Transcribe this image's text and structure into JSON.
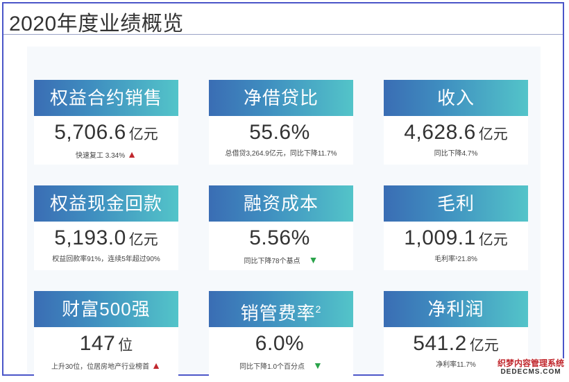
{
  "page": {
    "title": "2020年度业绩概览"
  },
  "cards": [
    {
      "title": "权益合约销售",
      "value": "5,706.6",
      "unit": "亿元",
      "note": "快速复工 3.34%",
      "arrow": "up"
    },
    {
      "title": "净借贷比",
      "value": "55.6%",
      "unit": "",
      "note": "总借贷3,264.9亿元，同比下降11.7%",
      "arrow": ""
    },
    {
      "title": "收入",
      "value": "4,628.6",
      "unit": "亿元",
      "note": "同比下降4.7%",
      "arrow": ""
    },
    {
      "title": "权益现金回款",
      "value": "5,193.0",
      "unit": "亿元",
      "note": "权益回款率91%，连续5年超过90%",
      "arrow": ""
    },
    {
      "title": "融资成本",
      "value": "5.56%",
      "unit": "",
      "note": "同比下降78个基点",
      "arrow": "down"
    },
    {
      "title": "毛利",
      "value": "1,009.1",
      "unit": "亿元",
      "note": "毛利率¹21.8%",
      "arrow": ""
    },
    {
      "title": "财富500强",
      "value": "147",
      "unit": "位",
      "note": "上升30位，位居房地产行业榜首",
      "arrow": "up"
    },
    {
      "title": "销管费率",
      "title_sup": "2",
      "value": "6.0%",
      "unit": "",
      "note": "同比下降1.0个百分点",
      "arrow": "down"
    },
    {
      "title": "净利润",
      "value": "541.2",
      "unit": "亿元",
      "note": "净利率11.7%",
      "arrow": ""
    }
  ],
  "watermark": {
    "cn": "织梦内容管理系统",
    "en": "DEDECMS.COM"
  },
  "colors": {
    "header_start": "#3a6db4",
    "header_end": "#53c4c9",
    "up_arrow": "#c1272d",
    "down_arrow": "#2aa34a",
    "frame": "#4a55c8"
  },
  "icons": {
    "up": "up-arrow-icon",
    "down": "down-arrow-icon"
  }
}
